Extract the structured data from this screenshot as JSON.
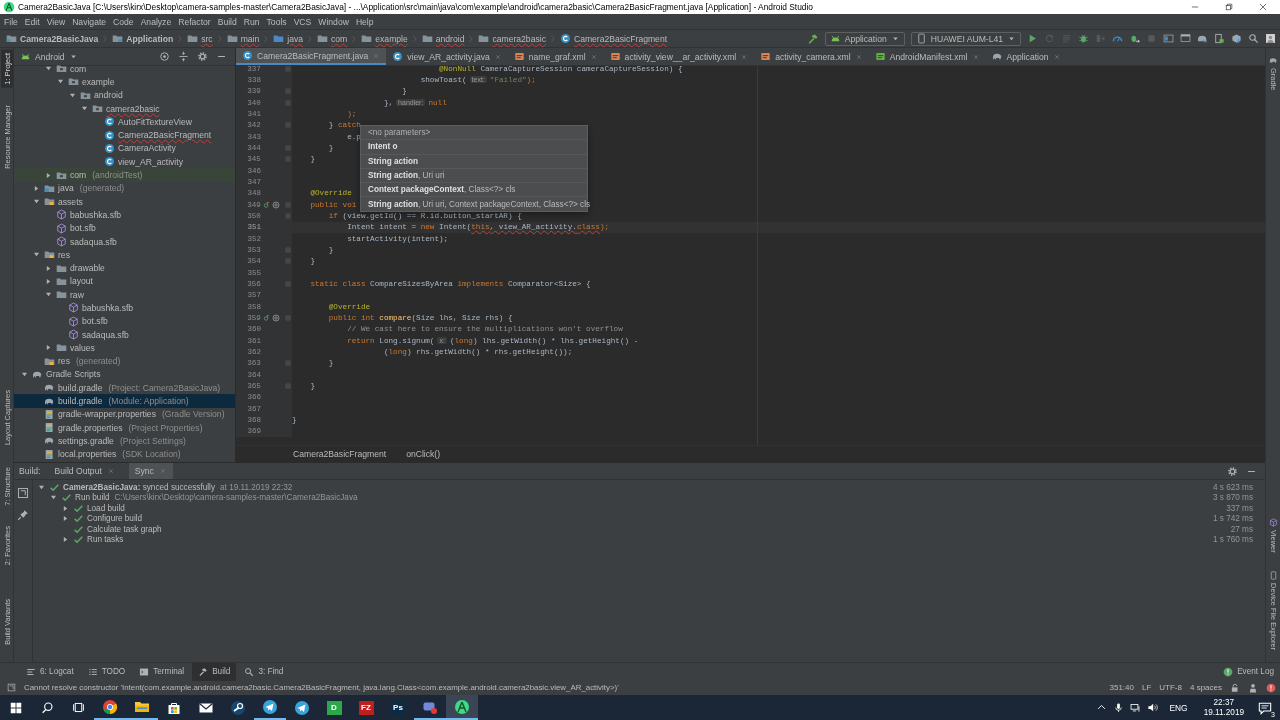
{
  "window": {
    "title": "Camera2BasicJava [C:\\Users\\kirx\\Desktop\\camera-samples-master\\Camera2BasicJava] - ...\\Application\\src\\main\\java\\com\\example\\android\\camera2basic\\Camera2BasicFragment.java [Application] - Android Studio"
  },
  "menu": [
    "File",
    "Edit",
    "View",
    "Navigate",
    "Code",
    "Analyze",
    "Refactor",
    "Build",
    "Run",
    "Tools",
    "VCS",
    "Window",
    "Help"
  ],
  "nav_path": [
    {
      "label": "Camera2BasicJava",
      "kind": "project",
      "error": false
    },
    {
      "label": "Application",
      "kind": "module",
      "error": false
    },
    {
      "label": "src",
      "kind": "folder",
      "error": true
    },
    {
      "label": "main",
      "kind": "folder",
      "error": true
    },
    {
      "label": "java",
      "kind": "source",
      "error": true
    },
    {
      "label": "com",
      "kind": "folder",
      "error": true
    },
    {
      "label": "example",
      "kind": "folder",
      "error": true
    },
    {
      "label": "android",
      "kind": "folder",
      "error": true
    },
    {
      "label": "camera2basic",
      "kind": "folder",
      "error": true
    },
    {
      "label": "Camera2BasicFragment",
      "kind": "class",
      "error": true
    }
  ],
  "run_toolbar": {
    "configuration": "Application",
    "device": "HUAWEI AUM-L41",
    "buttons": [
      {
        "kind": "run",
        "disabled": false
      },
      {
        "kind": "rerun",
        "disabled": true
      },
      {
        "kind": "apply",
        "disabled": true
      },
      {
        "kind": "debug",
        "disabled": false
      },
      {
        "kind": "attach",
        "disabled": true
      },
      {
        "kind": "profile",
        "disabled": false
      },
      {
        "kind": "debugapply",
        "disabled": false
      },
      {
        "kind": "stop",
        "disabled": true
      },
      {
        "kind": "structure",
        "disabled": false
      },
      {
        "kind": "avd",
        "disabled": false
      },
      {
        "kind": "sync",
        "disabled": false
      },
      {
        "kind": "inspector",
        "disabled": false
      },
      {
        "kind": "sdk",
        "disabled": false
      },
      {
        "kind": "search",
        "disabled": false
      },
      {
        "kind": "account",
        "disabled": false
      }
    ]
  },
  "left_stripe": {
    "top": [
      {
        "label": "1: Project",
        "selected": true
      },
      {
        "label": "Resource Manager",
        "selected": false
      }
    ],
    "middle": [
      {
        "label": "Layout Captures",
        "selected": false
      }
    ],
    "bottom": [
      {
        "label": "7: Structure",
        "selected": false
      },
      {
        "label": "2: Favorites",
        "selected": false
      }
    ],
    "end": [
      {
        "label": "Build Variants",
        "selected": false
      }
    ]
  },
  "right_stripe": {
    "top": [
      {
        "label": "Gradle",
        "kind": "gradle"
      }
    ],
    "bottom": [
      {
        "label": "Viewer",
        "kind": "model"
      },
      {
        "label": "Device File Explorer",
        "kind": "device"
      }
    ]
  },
  "project_view": "Android",
  "project_tree": [
    {
      "children": [
        {
          "children": [
            {
              "label": "com",
              "kind": "package",
              "expanded": true,
              "selected": false,
              "error": false,
              "children": [
                {
                  "label": "example",
                  "kind": "package",
                  "expanded": true,
                  "selected": false,
                  "error": false,
                  "children": [
                    {
                      "label": "android",
                      "kind": "package",
                      "expanded": true,
                      "selected": false,
                      "error": false,
                      "children": [
                        {
                          "label": "camera2basic",
                          "kind": "package",
                          "expanded": true,
                          "selected": false,
                          "error": true,
                          "children": [
                            {
                              "label": "AutoFitTextureView",
                              "kind": "class",
                              "selected": false,
                              "error": false
                            },
                            {
                              "label": "Camera2BasicFragment",
                              "kind": "class",
                              "selected": false,
                              "error": true
                            },
                            {
                              "label": "CameraActivity",
                              "kind": "class",
                              "selected": false,
                              "error": false
                            },
                            {
                              "label": "view_AR_activity",
                              "kind": "class",
                              "selected": false,
                              "error": false
                            }
                          ]
                        }
                      ]
                    }
                  ]
                }
              ]
            },
            {
              "label": "com",
              "suffix": "(androidTest)",
              "kind": "test-package",
              "expanded": false,
              "selected": false,
              "error": false
            }
          ]
        },
        {
          "label": "java",
          "suffix": "(generated)",
          "kind": "gen-folder",
          "expanded": false,
          "selected": false,
          "error": false
        },
        {
          "label": "assets",
          "kind": "res-folder",
          "expanded": true,
          "selected": false,
          "error": false,
          "children": [
            {
              "label": "babushka.sfb",
              "kind": "model",
              "selected": false,
              "error": false
            },
            {
              "label": "bot.sfb",
              "kind": "model",
              "selected": false,
              "error": false
            },
            {
              "label": "sadaqua.sfb",
              "kind": "model",
              "selected": false,
              "error": false
            }
          ]
        },
        {
          "label": "res",
          "kind": "res-folder",
          "expanded": true,
          "selected": false,
          "error": false,
          "children": [
            {
              "label": "drawable",
              "kind": "folder",
              "expanded": false,
              "selected": false,
              "error": false
            },
            {
              "label": "layout",
              "kind": "folder",
              "expanded": false,
              "selected": false,
              "error": false
            },
            {
              "label": "raw",
              "kind": "folder",
              "expanded": true,
              "selected": false,
              "error": false,
              "children": [
                {
                  "label": "babushka.sfb",
                  "kind": "model",
                  "selected": false,
                  "error": false
                },
                {
                  "label": "bot.sfb",
                  "kind": "model",
                  "selected": false,
                  "error": false
                },
                {
                  "label": "sadaqua.sfb",
                  "kind": "model",
                  "selected": false,
                  "error": false
                }
              ]
            },
            {
              "label": "values",
              "kind": "folder",
              "expanded": false,
              "selected": false,
              "error": false
            }
          ]
        },
        {
          "label": "res",
          "suffix": "(generated)",
          "kind": "res-folder",
          "selected": false,
          "error": false
        }
      ]
    },
    {
      "label": "Gradle Scripts",
      "kind": "gradle",
      "expanded": true,
      "selected": false,
      "error": false,
      "children": [
        {
          "label": "build.gradle",
          "suffix": "(Project: Camera2BasicJava)",
          "kind": "gradle",
          "selected": false,
          "error": false
        },
        {
          "label": "build.gradle",
          "suffix": "(Module: Application)",
          "kind": "gradle",
          "selected": true,
          "error": false
        },
        {
          "label": "gradle-wrapper.properties",
          "suffix": "(Gradle Version)",
          "kind": "properties",
          "selected": false,
          "error": false
        },
        {
          "label": "gradle.properties",
          "suffix": "(Project Properties)",
          "kind": "properties",
          "selected": false,
          "error": false
        },
        {
          "label": "settings.gradle",
          "suffix": "(Project Settings)",
          "kind": "gradle",
          "selected": false,
          "error": false
        },
        {
          "label": "local.properties",
          "suffix": "(SDK Location)",
          "kind": "properties",
          "selected": false,
          "error": false
        }
      ]
    }
  ],
  "editor_tabs": [
    {
      "label": "Camera2BasicFragment.java",
      "kind": "class",
      "selected": true
    },
    {
      "label": "view_AR_activity.java",
      "kind": "class",
      "selected": false
    },
    {
      "label": "name_graf.xml",
      "kind": "xml",
      "selected": false
    },
    {
      "label": "activity_view__ar_activity.xml",
      "kind": "xml",
      "selected": false
    },
    {
      "label": "activity_camera.xml",
      "kind": "xml",
      "selected": false
    },
    {
      "label": "AndroidManifest.xml",
      "kind": "manifest",
      "selected": false
    },
    {
      "label": "Application",
      "kind": "gradle",
      "selected": false
    }
  ],
  "code_lines": [
    {
      "n": "337",
      "tokens": [
        {
          "t": "                                @NonNull",
          "kind": "annotation"
        },
        {
          "t": " CameraCaptureSession cameraCaptureSession) {",
          "kind": "plain"
        }
      ],
      "fold": true,
      "override": false,
      "current": false
    },
    {
      "n": "338",
      "tokens": [
        {
          "t": "                            showToast(",
          "kind": "plain"
        },
        {
          "t": "text:",
          "kind": "hint"
        },
        {
          "t": "\"Failed\"",
          "kind": "string"
        },
        {
          "t": ");",
          "kind": "punct"
        }
      ],
      "fold": false,
      "override": false,
      "current": false
    },
    {
      "n": "339",
      "tokens": [
        {
          "t": "                        }",
          "kind": "plain"
        }
      ],
      "fold": true,
      "override": false,
      "current": false
    },
    {
      "n": "340",
      "tokens": [
        {
          "t": "                    },",
          "kind": "plain"
        },
        {
          "t": "handler:",
          "kind": "hint"
        },
        {
          "t": "null",
          "kind": "keyword"
        }
      ],
      "fold": true,
      "override": false,
      "current": false
    },
    {
      "n": "341",
      "tokens": [
        {
          "t": "            );",
          "kind": "punct"
        }
      ],
      "fold": false,
      "override": false,
      "current": false
    },
    {
      "n": "342",
      "tokens": [
        {
          "t": "        } ",
          "kind": "plain"
        },
        {
          "t": "catch",
          "kind": "keyword"
        }
      ],
      "fold": true,
      "override": false,
      "current": false
    },
    {
      "n": "343",
      "tokens": [
        {
          "t": "            e.p",
          "kind": "plain"
        }
      ],
      "fold": false,
      "override": false,
      "current": false
    },
    {
      "n": "344",
      "tokens": [
        {
          "t": "        }",
          "kind": "plain"
        }
      ],
      "fold": true,
      "override": false,
      "current": false
    },
    {
      "n": "345",
      "tokens": [
        {
          "t": "    }",
          "kind": "plain"
        }
      ],
      "fold": true,
      "override": false,
      "current": false
    },
    {
      "n": "346",
      "fold": false,
      "override": false,
      "current": false
    },
    {
      "n": "347",
      "fold": false,
      "override": false,
      "current": false
    },
    {
      "n": "348",
      "tokens": [
        {
          "t": "    @Override",
          "kind": "annotation"
        }
      ],
      "fold": false,
      "override": false,
      "current": false
    },
    {
      "n": "349",
      "tokens": [
        {
          "t": "    public voi",
          "kind": "keyword"
        }
      ],
      "fold": true,
      "override": true,
      "current": false
    },
    {
      "n": "350",
      "tokens": [
        {
          "t": "        if",
          "kind": "keyword"
        },
        {
          "t": " (view.getId() == R.id.button_startAR) {",
          "kind": "plain"
        }
      ],
      "fold": true,
      "override": false,
      "current": false
    },
    {
      "n": "351",
      "tokens": [
        {
          "t": "            Intent intent = ",
          "kind": "plain"
        },
        {
          "t": "new",
          "kind": "keyword"
        },
        {
          "t": " Intent(",
          "kind": "plain"
        },
        {
          "t": "this",
          "kind": "error-keyword"
        },
        {
          "t": ", view_AR_activity.",
          "kind": "error"
        },
        {
          "t": "class",
          "kind": "error-keyword"
        },
        {
          "t": ");",
          "kind": "punct"
        }
      ],
      "fold": false,
      "override": false,
      "current": true
    },
    {
      "n": "352",
      "tokens": [
        {
          "t": "            startActivity(intent);",
          "kind": "plain"
        }
      ],
      "fold": false,
      "override": false,
      "current": false
    },
    {
      "n": "353",
      "tokens": [
        {
          "t": "        }",
          "kind": "plain"
        }
      ],
      "fold": true,
      "override": false,
      "current": false
    },
    {
      "n": "354",
      "tokens": [
        {
          "t": "    }",
          "kind": "plain"
        }
      ],
      "fold": true,
      "override": false,
      "current": false
    },
    {
      "n": "355",
      "fold": false,
      "override": false,
      "current": false
    },
    {
      "n": "356",
      "tokens": [
        {
          "t": "    static class",
          "kind": "keyword"
        },
        {
          "t": " CompareSizesByArea ",
          "kind": "plain"
        },
        {
          "t": "implements",
          "kind": "keyword"
        },
        {
          "t": " Comparator<Size> {",
          "kind": "plain"
        }
      ],
      "fold": true,
      "override": false,
      "current": false
    },
    {
      "n": "357",
      "fold": false,
      "override": false,
      "current": false
    },
    {
      "n": "358",
      "tokens": [
        {
          "t": "        @Override",
          "kind": "annotation"
        }
      ],
      "fold": false,
      "override": false,
      "current": false
    },
    {
      "n": "359",
      "tokens": [
        {
          "t": "        public int ",
          "kind": "keyword"
        },
        {
          "t": "compare",
          "kind": "method"
        },
        {
          "t": "(Size lhs, Size rhs) {",
          "kind": "plain"
        }
      ],
      "fold": true,
      "override": true,
      "current": false
    },
    {
      "n": "360",
      "tokens": [
        {
          "t": "            // We cast here to ensure the multiplications won't overflow",
          "kind": "comment"
        }
      ],
      "fold": false,
      "override": false,
      "current": false
    },
    {
      "n": "361",
      "tokens": [
        {
          "t": "            return",
          "kind": "keyword"
        },
        {
          "t": " Long.signum(",
          "kind": "plain"
        },
        {
          "t": "x:",
          "kind": "hint"
        },
        {
          "t": "(",
          "kind": "plain"
        },
        {
          "t": "long",
          "kind": "keyword"
        },
        {
          "t": ") lhs.getWidth() * lhs.getHeight() -",
          "kind": "plain"
        }
      ],
      "fold": false,
      "override": false,
      "current": false
    },
    {
      "n": "362",
      "tokens": [
        {
          "t": "                    (",
          "kind": "plain"
        },
        {
          "t": "long",
          "kind": "keyword"
        },
        {
          "t": ") rhs.getWidth() * rhs.getHeight());",
          "kind": "plain"
        }
      ],
      "fold": false,
      "override": false,
      "current": false
    },
    {
      "n": "363",
      "tokens": [
        {
          "t": "        }",
          "kind": "plain"
        }
      ],
      "fold": true,
      "override": false,
      "current": false
    },
    {
      "n": "364",
      "fold": false,
      "override": false,
      "current": false
    },
    {
      "n": "365",
      "tokens": [
        {
          "t": "    }",
          "kind": "plain"
        }
      ],
      "fold": true,
      "override": false,
      "current": false
    },
    {
      "n": "366",
      "fold": false,
      "override": false,
      "current": false
    },
    {
      "n": "367",
      "fold": false,
      "override": false,
      "current": false
    },
    {
      "n": "368",
      "tokens": [
        {
          "t": "}",
          "kind": "plain"
        }
      ],
      "fold": false,
      "override": false,
      "current": false
    },
    {
      "n": "369",
      "fold": false,
      "override": false,
      "current": false
    }
  ],
  "parameter_popup": [
    {
      "text": "<no parameters>"
    },
    {
      "bold": "Intent o"
    },
    {
      "bold": "String action"
    },
    {
      "bold": "String action",
      "rest": ", Uri uri"
    },
    {
      "bold": "Context packageContext",
      "rest": ", Class<?> cls"
    },
    {
      "bold": "String action",
      "rest": ", Uri uri, Context packageContext, Class<?> cls"
    }
  ],
  "editor_breadcrumbs": [
    "Camera2BasicFragment",
    "onClick()"
  ],
  "build": {
    "label": "Build:",
    "tabs": [
      {
        "label": "Build Output",
        "selected": false
      },
      {
        "label": "Sync",
        "selected": true
      }
    ],
    "tree": [
      {
        "label": "**Camera2BasicJava:** synced successfully",
        "detail": "at 19.11.2019 22:32",
        "time": "4 s 623 ms",
        "expanded": true,
        "children": [
          {
            "label": "Run build",
            "detail": "C:\\Users\\kirx\\Desktop\\camera-samples-master\\Camera2BasicJava",
            "time": "3 s 870 ms",
            "expanded": true,
            "children": [
              {
                "label": "Load build",
                "time": "337 ms",
                "expanded": false
              },
              {
                "label": "Configure build",
                "time": "1 s 742 ms",
                "expanded": false
              },
              {
                "label": "Calculate task graph",
                "time": "27 ms"
              },
              {
                "label": "Run tasks",
                "time": "1 s 760 ms",
                "expanded": false
              }
            ]
          }
        ]
      }
    ]
  },
  "tool_tabs": [
    {
      "label": "6: Logcat",
      "kind": "logcat",
      "selected": false
    },
    {
      "label": "TODO",
      "kind": "todo",
      "selected": false
    },
    {
      "label": "Terminal",
      "kind": "terminal",
      "selected": false
    },
    {
      "label": "Build",
      "kind": "build",
      "selected": true
    },
    {
      "label": "3: Find",
      "kind": "find",
      "selected": false
    }
  ],
  "event_log": "Event Log",
  "status_bar": {
    "message": "Cannot resolve constructor 'Intent(com.example.android.camera2basic.Camera2BasicFragment, java.lang.Class<com.example.android.camera2basic.view_AR_activity>)'",
    "position": "351:40",
    "line_separator": "LF",
    "encoding": "UTF-8",
    "indent": "4 spaces"
  },
  "taskbar": {
    "apps": [
      {
        "kind": "browser",
        "running": true,
        "selected": false
      },
      {
        "kind": "files",
        "running": true,
        "selected": false
      },
      {
        "kind": "store",
        "running": false,
        "selected": false
      },
      {
        "kind": "mail",
        "running": false,
        "selected": false
      },
      {
        "kind": "steam",
        "running": false,
        "selected": false
      },
      {
        "kind": "plane",
        "running": true,
        "selected": false
      },
      {
        "kind": "plane",
        "running": false,
        "selected": false
      },
      {
        "kind": "tile",
        "glyph": "D",
        "color": "#2aa84a",
        "running": false,
        "selected": false
      },
      {
        "kind": "tile",
        "glyph": "FZ",
        "color": "#bf1e1e",
        "running": false,
        "selected": false
      },
      {
        "kind": "tile",
        "glyph": "Ps",
        "color": "#0b2a45",
        "running": false,
        "selected": false
      },
      {
        "kind": "game",
        "running": true,
        "selected": false
      },
      {
        "kind": "studio",
        "running": true,
        "selected": true
      }
    ],
    "language": "ENG",
    "time": "22:37",
    "date": "19.11.2019",
    "notifications": "3"
  }
}
